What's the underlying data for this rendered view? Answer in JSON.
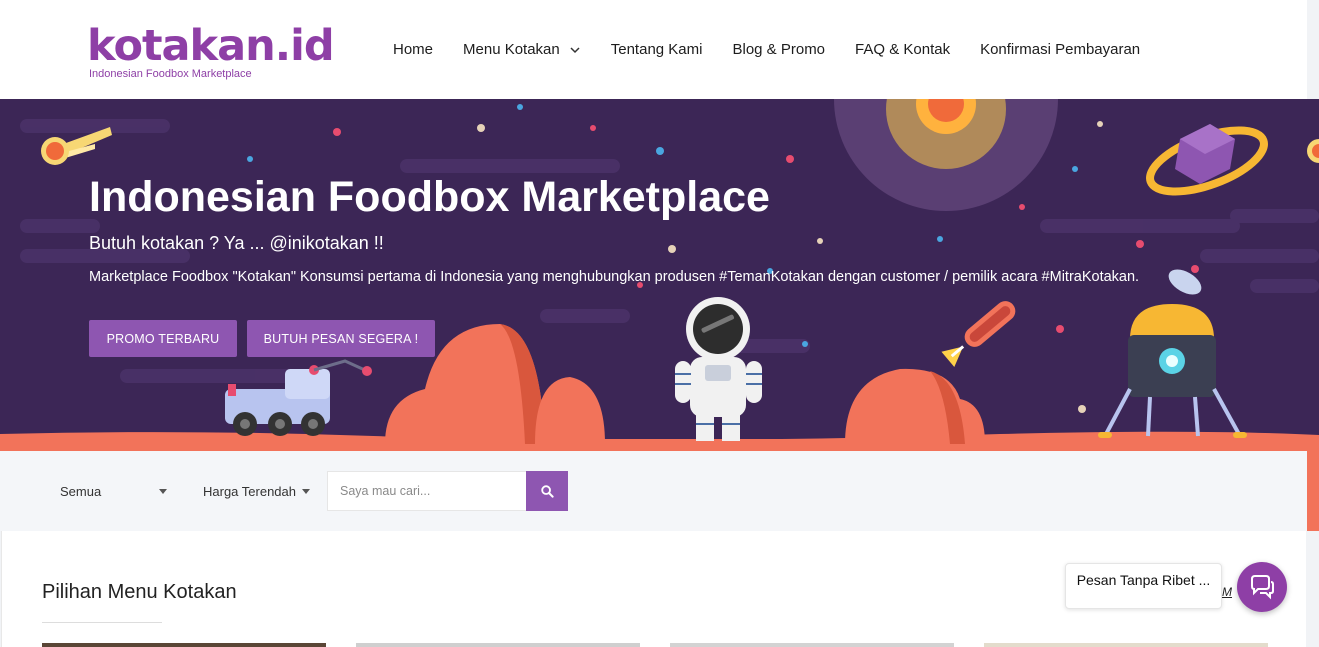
{
  "header": {
    "logo_text": "kotakan.id",
    "logo_tagline": "Indonesian Foodbox Marketplace",
    "nav": [
      {
        "label": "Home"
      },
      {
        "label": "Menu Kotakan",
        "has_dropdown": true
      },
      {
        "label": "Tentang Kami"
      },
      {
        "label": "Blog & Promo"
      },
      {
        "label": "FAQ & Kontak"
      },
      {
        "label": "Konfirmasi Pembayaran"
      }
    ]
  },
  "hero": {
    "title": "Indonesian Foodbox Marketplace",
    "subtitle": "Butuh kotakan ? Ya ... @inikotakan !!",
    "description": "Marketplace Foodbox \"Kotakan\" Konsumsi pertama di Indonesia yang menghubungkan produsen #TemanKotakan dengan customer / pemilik acara #MitraKotakan.",
    "buttons": {
      "promo": "PROMO TERBARU",
      "order": "BUTUH PESAN SEGERA !"
    }
  },
  "filter": {
    "category_selected": "Semua",
    "sort_selected": "Harga Terendah",
    "search_placeholder": "Saya mau cari..."
  },
  "content": {
    "section_title": "Pilihan Menu Kotakan",
    "see_all_partial": "a M"
  },
  "chat": {
    "bubble_text": "Pesan Tanpa Ribet ..."
  },
  "colors": {
    "brand_purple": "#8e3fa6",
    "button_purple": "#8e56b1",
    "hero_bg": "#3c2656",
    "ground_orange": "#f2735a"
  },
  "icons": [
    "chevron-down-icon",
    "search-icon",
    "chat-icon"
  ]
}
